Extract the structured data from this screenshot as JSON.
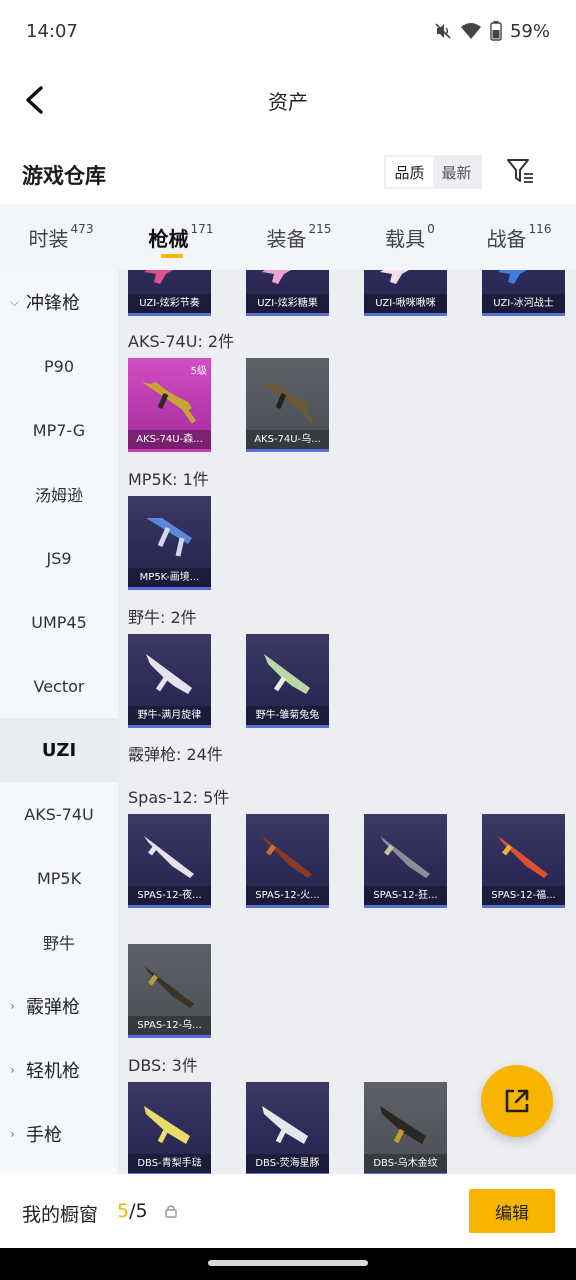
{
  "status": {
    "time": "14:07",
    "battery": "59%",
    "icons": [
      "mute-icon",
      "wifi-icon",
      "battery-icon"
    ]
  },
  "nav": {
    "title": "资产",
    "back_icon": "back-arrow-icon"
  },
  "header": {
    "title": "游戏仓库",
    "sort": [
      "品质",
      "最新"
    ],
    "sort_selected": "品质",
    "filter_icon": "filter-icon"
  },
  "tabs": [
    {
      "label": "时装",
      "count": "473"
    },
    {
      "label": "枪械",
      "count": "171",
      "active": true
    },
    {
      "label": "装备",
      "count": "215"
    },
    {
      "label": "载具",
      "count": "0"
    },
    {
      "label": "战备",
      "count": "116"
    }
  ],
  "sidebar": [
    {
      "label": "冲锋枪",
      "group": true,
      "expanded": true
    },
    {
      "label": "P90"
    },
    {
      "label": "MP7-G"
    },
    {
      "label": "汤姆逊"
    },
    {
      "label": "JS9"
    },
    {
      "label": "UMP45"
    },
    {
      "label": "Vector"
    },
    {
      "label": "UZI",
      "active": true
    },
    {
      "label": "AKS-74U"
    },
    {
      "label": "MP5K"
    },
    {
      "label": "野牛"
    },
    {
      "label": "霰弹枪",
      "group": true
    },
    {
      "label": "轻机枪",
      "group": true
    },
    {
      "label": "手枪",
      "group": true
    }
  ],
  "sections": {
    "uzi_items": [
      "UZI-炫彩节奏",
      "UZI-炫彩糖果",
      "UZI-啾咪啾咪",
      "UZI-冰河战士"
    ],
    "aks": {
      "label": "AKS-74U: 2件",
      "items": [
        "AKS-74U-森...",
        "AKS-74U-乌..."
      ],
      "level": "5级"
    },
    "mp5k": {
      "label": "MP5K: 1件",
      "items": [
        "MP5K-画境..."
      ]
    },
    "bison": {
      "label": "野牛: 2件",
      "items": [
        "野牛-满月旋律",
        "野牛-雏菊兔兔"
      ]
    },
    "shotgun_header": "霰弹枪: 24件",
    "spas": {
      "label": "Spas-12: 5件",
      "items": [
        "SPAS-12-夜...",
        "SPAS-12-火...",
        "SPAS-12-狂...",
        "SPAS-12-福...",
        "SPAS-12-乌..."
      ]
    },
    "dbs": {
      "label": "DBS: 3件",
      "items": [
        "DBS-青梨手琺",
        "DBS-荧海星豚",
        "DBS-乌木金纹"
      ]
    }
  },
  "bottom": {
    "title": "我的橱窗",
    "current": "5",
    "total": "/5",
    "edit": "编辑",
    "lock_icon": "lock-icon",
    "share_icon": "share-external-icon"
  },
  "colors": {
    "accent": "#f7b500",
    "card_purple": "#2c2a57",
    "card_pink": "#b533a8",
    "card_gray": "#51555c"
  }
}
